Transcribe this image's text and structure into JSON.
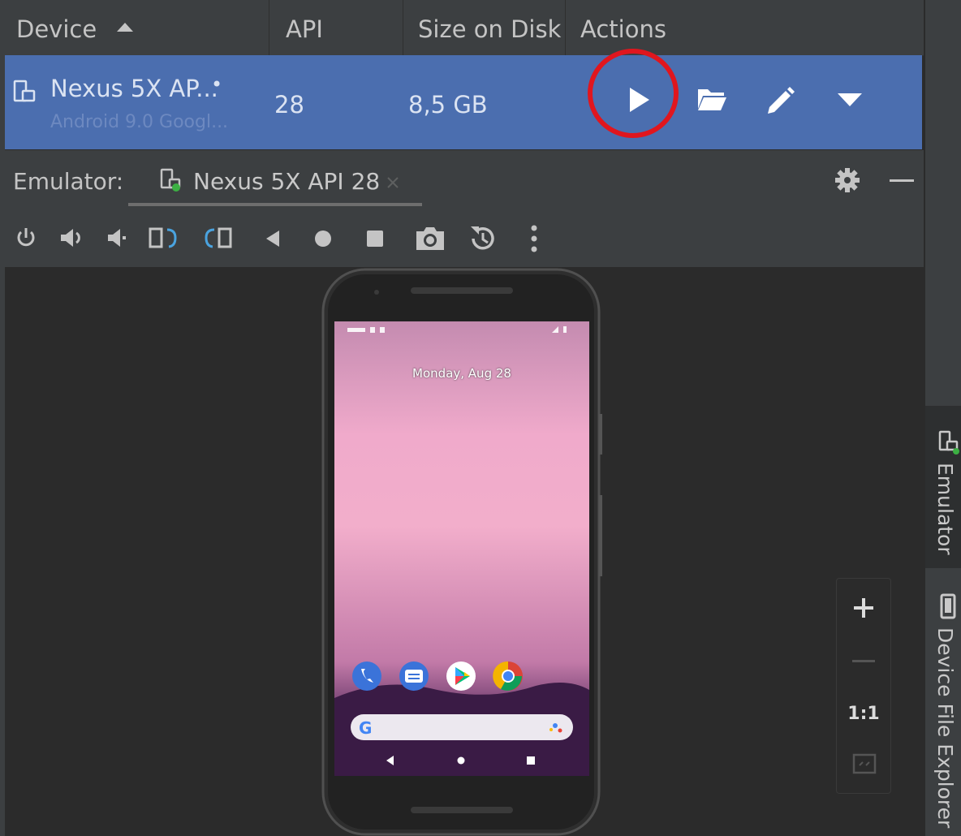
{
  "table": {
    "columns": [
      {
        "label": "Device"
      },
      {
        "label": "API"
      },
      {
        "label": "Size on Disk"
      },
      {
        "label": "Actions"
      }
    ],
    "row": {
      "device_name": "Nexus 5X AP...",
      "device_status": "•",
      "device_sub": "Android 9.0 Googl...",
      "api": "28",
      "size": "8,5 GB"
    }
  },
  "emulator": {
    "label": "Emulator:",
    "tab_title": "Nexus 5X API 28"
  },
  "phone": {
    "date": "Monday, Aug 28"
  },
  "zoom": {
    "one_to_one": "1:1"
  },
  "side_panels": {
    "emulator": "Emulator",
    "device_file_explorer": "Device File Explorer"
  },
  "colors": {
    "selection": "#4b6eaf",
    "highlight_circle": "#e0161e",
    "panel": "#3c3f41",
    "background": "#2b2b2b"
  }
}
